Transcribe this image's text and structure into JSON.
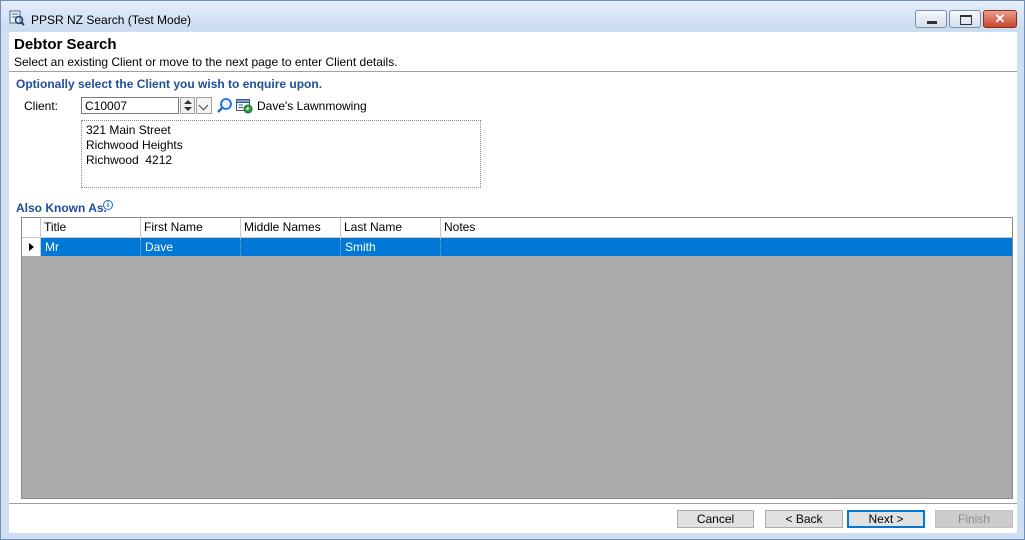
{
  "window": {
    "title": "PPSR NZ Search (Test Mode)",
    "controls": {
      "close": "✕"
    }
  },
  "header": {
    "title": "Debtor Search",
    "subtitle": "Select an existing Client or move to the next page to enter Client details."
  },
  "client_section": {
    "heading": "Optionally select the Client you wish to enquire upon.",
    "label": "Client:",
    "code": "C10007",
    "name": "Dave's Lawnmowing",
    "address_lines": [
      "321 Main Street",
      "Richwood Heights",
      "Richwood  4212"
    ]
  },
  "aka_section": {
    "heading": "Also Known As.",
    "info_glyph": "i",
    "columns": [
      "Title",
      "First Name",
      "Middle Names",
      "Last Name",
      "Notes"
    ],
    "rows": [
      [
        "Mr",
        "Dave",
        "",
        "Smith",
        ""
      ]
    ]
  },
  "footer": {
    "cancel": "Cancel",
    "back": "< Back",
    "next": "Next >",
    "finish": "Finish"
  },
  "colors": {
    "accent": "#1f4e99",
    "selection": "#0078d7",
    "grid_empty": "#ababab"
  }
}
